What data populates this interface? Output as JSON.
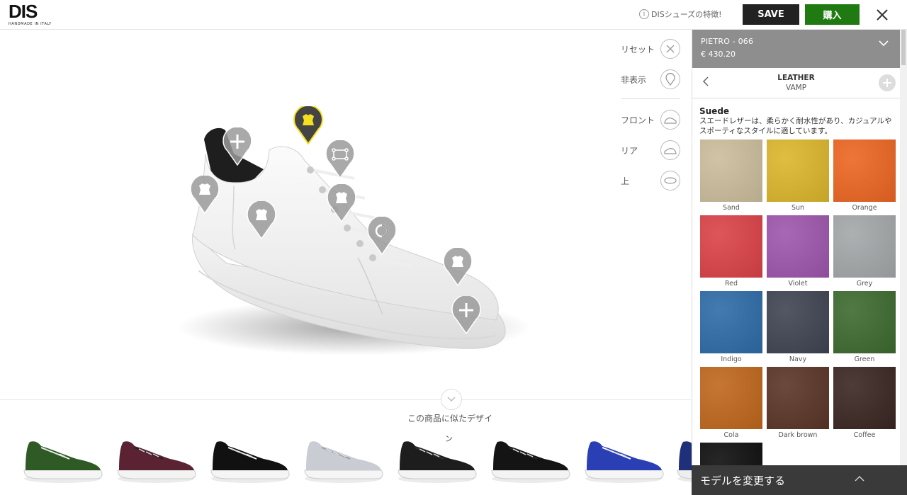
{
  "brand": {
    "logo": "DIS",
    "tagline": "HANDMADE IN ITALY"
  },
  "header": {
    "features_link": "DISシューズの特徴!",
    "save_label": "SAVE",
    "buy_label": "購入"
  },
  "view_controls": [
    {
      "label": "リセット",
      "icon": "reset-icon"
    },
    {
      "label": "非表示",
      "icon": "hide-pins-icon"
    },
    {
      "label": "フロント",
      "icon": "front-view-icon"
    },
    {
      "label": "リア",
      "icon": "rear-view-icon"
    },
    {
      "label": "上",
      "icon": "top-view-icon"
    }
  ],
  "similar": {
    "title": "この商品に似たデザイ",
    "overflow_text": "ン"
  },
  "product": {
    "name": "PIETRO - 066",
    "price": "€ 430.20"
  },
  "breadcrumb": {
    "category": "LEATHER",
    "part": "VAMP"
  },
  "material": {
    "name": "Suede",
    "description_line1": "スエードレザーは、柔らかく耐水性があり、カジュアルや",
    "description_line2": "スポーティなスタイルに適しています。"
  },
  "swatches": [
    {
      "name": "Sand",
      "color": "#cbbd9d"
    },
    {
      "name": "Sun",
      "color": "#dcb62c"
    },
    {
      "name": "Orange",
      "color": "#ec6621"
    },
    {
      "name": "Red",
      "color": "#db4247"
    },
    {
      "name": "Violet",
      "color": "#9e56ad"
    },
    {
      "name": "Grey",
      "color": "#a4a7a9"
    },
    {
      "name": "Indigo",
      "color": "#2e6ca8"
    },
    {
      "name": "Navy",
      "color": "#3f4452"
    },
    {
      "name": "Green",
      "color": "#3d6a2f"
    },
    {
      "name": "Cola",
      "color": "#c0671c"
    },
    {
      "name": "Dark brown",
      "color": "#5a3527"
    },
    {
      "name": "Coffee",
      "color": "#3a2622"
    },
    {
      "name": "",
      "color": "#0e0e0e"
    }
  ],
  "bottom_bar": {
    "label": "モデルを変更する"
  },
  "thumbnails": [
    {
      "upper": "#2f5a25",
      "accent": "#f2f2f2",
      "sole": "#f5f5f5"
    },
    {
      "upper": "#5b2234",
      "accent": "#222",
      "sole": "#f3f3f3"
    },
    {
      "upper": "#111",
      "accent": "#f5f5f5",
      "sole": "#f5f5f5"
    },
    {
      "upper": "#c9ccd3",
      "accent": "#9aa0aa",
      "sole": "#f5f5f5"
    },
    {
      "upper": "#1d1d1d",
      "accent": "#333",
      "sole": "#f3f3f3"
    },
    {
      "upper": "#141414",
      "accent": "#2a2a2a",
      "sole": "#f3f3f3"
    },
    {
      "upper": "#2a3fb3",
      "accent": "#fff",
      "sole": "#f5f5f5"
    },
    {
      "upper": "#1f2f7a",
      "accent": "#fff",
      "sole": "#eee"
    }
  ],
  "colors": {
    "save": "#222222",
    "buy": "#1f7a12",
    "pin": "#9a9a9a",
    "pin_active": "#444444",
    "pin_active_icon": "#f5e020",
    "panel_head": "#8e8e8e"
  }
}
